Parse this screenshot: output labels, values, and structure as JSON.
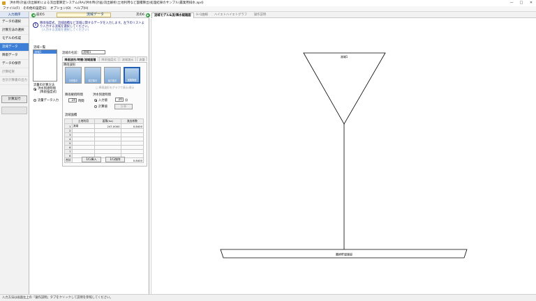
{
  "window": {
    "title": "洪水時(計画)流出解析による流出量算定システム(RA)/洪水時(計画)流出解析(土地利用など面積算出)処理結果のサンプル(農業用排水.apd)",
    "minimize": "—",
    "maximize": "□",
    "close": "✕"
  },
  "menu": [
    "ファイル(F)",
    "その他の設定(E)",
    "オプション(O)",
    "ヘルプ(H)"
  ],
  "nav": {
    "header": "入力順序",
    "items": [
      {
        "label": "データの選択",
        "state": "normal"
      },
      {
        "label": "計算方法の選択",
        "state": "normal"
      },
      {
        "label": "モデルの作成",
        "state": "normal"
      },
      {
        "label": "流域データ",
        "state": "active"
      },
      {
        "label": "降雨データ",
        "state": "normal"
      },
      {
        "label": "データの保存",
        "state": "normal"
      },
      {
        "label": "計算結果",
        "state": "dim"
      },
      {
        "label": "合計計算書の出力",
        "state": "dim"
      }
    ],
    "run_button": "計算実行",
    "disabled_button": "　"
  },
  "mid": {
    "back": "前の5",
    "title": "流域データ",
    "next": "次の6",
    "info_line1": "降雨強度式、流域面積など流域に関するデータを入力します。左下のリストより入力する流域を選択してください。",
    "info_line2": "（入力する流域を選択してください）",
    "list_label": "流域一覧",
    "list_items": [
      "流域1"
    ],
    "name_label": "流域の名前：",
    "name_value": "流域1",
    "tabs": [
      "降雨波形/時間/流域面積",
      "降雨強度式",
      "流域諸元",
      "流量"
    ],
    "shape_group_label": "降雨波形",
    "shapes": [
      "中央集中",
      "前方集中",
      "後方集中",
      "実績降雨"
    ],
    "shape_note": "□ 降雨波形をグラフで表示/表示",
    "flow_method_label": "流量の計算方法",
    "flow_method_opt1": "洪水到達時間（降雨強度式）",
    "flow_method_opt2": "流量データ入力",
    "rain_duration_label": "降雨継続時間",
    "rain_duration_value": "24",
    "rain_duration_unit": "時間",
    "arrival_label": "洪水到達時間",
    "arrival_opt1": "入力値",
    "arrival_value": "20",
    "arrival_unit": "分",
    "arrival_opt2": "計算値",
    "calc_button": "計算",
    "table_label": "流域面積",
    "table_headers": [
      "土地利用",
      "面積(ha)",
      "流出係数"
    ],
    "table_rows": [
      {
        "n": "1",
        "land": "流域",
        "area": "247.0000",
        "coef": "0.8400"
      },
      {
        "n": "2",
        "land": "",
        "area": "",
        "coef": ""
      },
      {
        "n": "3",
        "land": "",
        "area": "",
        "coef": ""
      },
      {
        "n": "4",
        "land": "",
        "area": "",
        "coef": ""
      },
      {
        "n": "5",
        "land": "",
        "area": "",
        "coef": ""
      },
      {
        "n": "6",
        "land": "",
        "area": "",
        "coef": ""
      },
      {
        "n": "7",
        "land": "",
        "area": "",
        "coef": ""
      },
      {
        "n": "8",
        "land": "",
        "area": "",
        "coef": ""
      }
    ],
    "total": {
      "label": "合計",
      "land": "─",
      "area": "247.0000",
      "coef": "0.8400"
    },
    "insert_button": "1行挿入",
    "delete_button": "1行削除"
  },
  "right": {
    "tabs": [
      "流域モデル&流/降水経路図",
      "H-Q曲線",
      "ハイエトハイエトグラフ",
      "操作説明"
    ],
    "basin_label": "流域1",
    "outlet_label": "最終貯留施設"
  },
  "status": "入力方法は画面左上の「操作説明」タブをクリックして説明を参照してください。",
  "colors": {
    "accent": "#3d7fd6",
    "title_bg": "#fff8d8",
    "go": "#2f9c3e"
  }
}
